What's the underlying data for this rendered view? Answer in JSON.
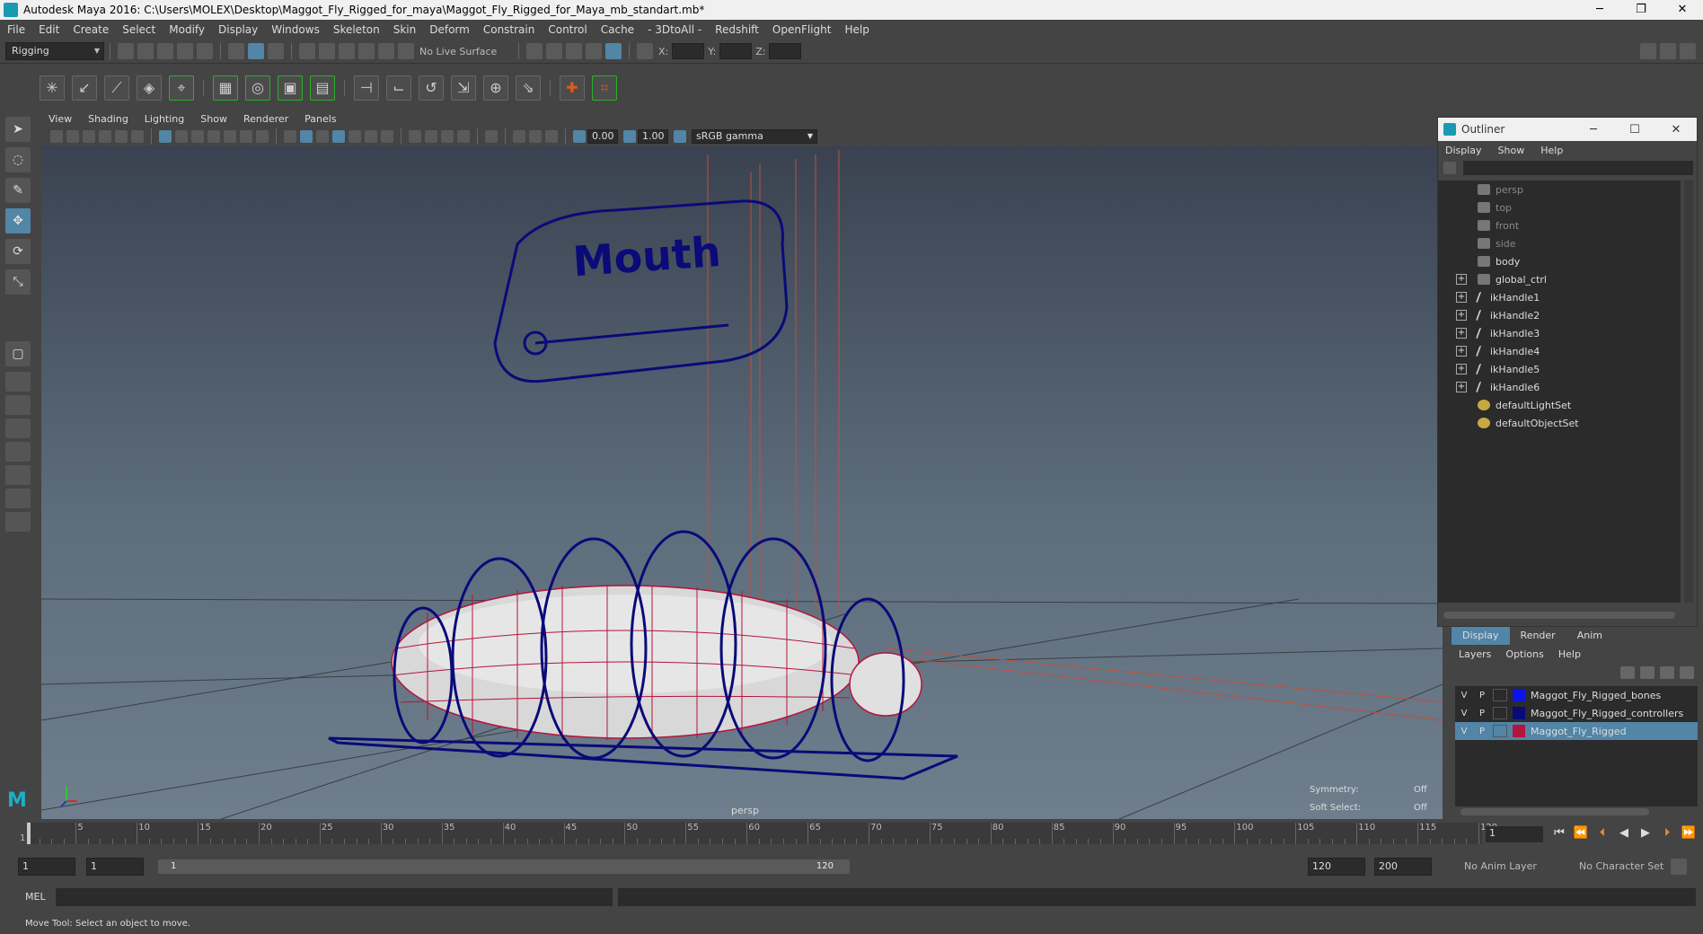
{
  "window": {
    "title": "Autodesk Maya 2016: C:\\Users\\MOLEX\\Desktop\\Maggot_Fly_Rigged_for_maya\\Maggot_Fly_Rigged_for_Maya_mb_standart.mb*",
    "minimize": "─",
    "restore": "❐",
    "close": "✕"
  },
  "menubar": [
    "File",
    "Edit",
    "Create",
    "Select",
    "Modify",
    "Display",
    "Windows",
    "Skeleton",
    "Skin",
    "Deform",
    "Constrain",
    "Control",
    "Cache",
    "- 3DtoAll -",
    "Redshift",
    "OpenFlight",
    "Help"
  ],
  "statusline": {
    "menuset": "Rigging",
    "live_surface": "No Live Surface",
    "x_label": "X:",
    "y_label": "Y:",
    "z_label": "Z:"
  },
  "panel_menu": [
    "View",
    "Shading",
    "Lighting",
    "Show",
    "Renderer",
    "Panels"
  ],
  "panel_bar": {
    "exposure": "0.00",
    "gamma": "1.00",
    "color_space": "sRGB gamma"
  },
  "viewport": {
    "camera_label": "persp",
    "mouth_label": "Mouth",
    "symmetry_label": "Symmetry:",
    "symmetry_value": "Off",
    "soft_select_label": "Soft Select:",
    "soft_select_value": "Off"
  },
  "outliner": {
    "title": "Outliner",
    "menu": [
      "Display",
      "Show",
      "Help"
    ],
    "items": [
      {
        "label": "persp",
        "dim": true,
        "expandable": false,
        "icon": "camera"
      },
      {
        "label": "top",
        "dim": true,
        "expandable": false,
        "icon": "camera"
      },
      {
        "label": "front",
        "dim": true,
        "expandable": false,
        "icon": "camera"
      },
      {
        "label": "side",
        "dim": true,
        "expandable": false,
        "icon": "camera"
      },
      {
        "label": "body",
        "dim": false,
        "expandable": false,
        "icon": "mesh"
      },
      {
        "label": "global_ctrl",
        "dim": false,
        "expandable": true,
        "icon": "mesh"
      },
      {
        "label": "ikHandle1",
        "dim": false,
        "expandable": true,
        "icon": "ik"
      },
      {
        "label": "ikHandle2",
        "dim": false,
        "expandable": true,
        "icon": "ik"
      },
      {
        "label": "ikHandle3",
        "dim": false,
        "expandable": true,
        "icon": "ik"
      },
      {
        "label": "ikHandle4",
        "dim": false,
        "expandable": true,
        "icon": "ik"
      },
      {
        "label": "ikHandle5",
        "dim": false,
        "expandable": true,
        "icon": "ik"
      },
      {
        "label": "ikHandle6",
        "dim": false,
        "expandable": true,
        "icon": "ik"
      },
      {
        "label": "defaultLightSet",
        "dim": false,
        "expandable": false,
        "icon": "set"
      },
      {
        "label": "defaultObjectSet",
        "dim": false,
        "expandable": false,
        "icon": "set"
      }
    ]
  },
  "layer_editor": {
    "tabs": [
      "Display",
      "Render",
      "Anim"
    ],
    "active_tab": "Display",
    "menu": [
      "Layers",
      "Options",
      "Help"
    ],
    "layers": [
      {
        "v": "V",
        "p": "P",
        "color": "#0a14e6",
        "name": "Maggot_Fly_Rigged_bones",
        "selected": false
      },
      {
        "v": "V",
        "p": "P",
        "color": "#0a0a78",
        "name": "Maggot_Fly_Rigged_controllers",
        "selected": false
      },
      {
        "v": "V",
        "p": "P",
        "color": "#b4143c",
        "name": "Maggot_Fly_Rigged",
        "selected": true
      }
    ]
  },
  "timeline": {
    "start": 1,
    "end": 120,
    "step": 5,
    "current_frame": "1"
  },
  "range": {
    "start_field": "1",
    "current_start": "1",
    "slider_start": "1",
    "slider_end": "120",
    "end_field": "120",
    "max_field": "200",
    "anim_layer": "No Anim Layer",
    "character_set": "No Character Set"
  },
  "command": {
    "label": "MEL"
  },
  "help_line": "Move Tool: Select an object to move.",
  "colors": {
    "accent": "#5285a6",
    "wire": "#0a0a78",
    "mesh_wire": "#b4143c"
  }
}
